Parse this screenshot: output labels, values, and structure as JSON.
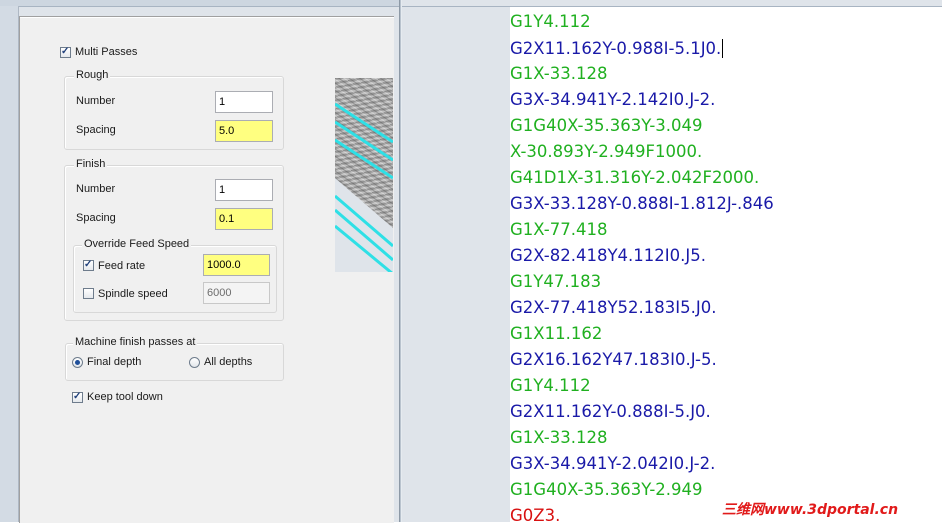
{
  "dialog": {
    "multi_passes": {
      "label": "Multi Passes",
      "checked": true
    },
    "rough": {
      "caption": "Rough",
      "number_label": "Number",
      "number_value": "1",
      "spacing_label": "Spacing",
      "spacing_value": "5.0"
    },
    "finish": {
      "caption": "Finish",
      "number_label": "Number",
      "number_value": "1",
      "spacing_label": "Spacing",
      "spacing_value": "0.1",
      "override": {
        "caption": "Override Feed Speed",
        "feed_rate_label": "Feed rate",
        "feed_rate_checked": true,
        "feed_rate_value": "1000.0",
        "spindle_label": "Spindle speed",
        "spindle_checked": false,
        "spindle_value": "6000"
      }
    },
    "machine_finish": {
      "caption": "Machine finish passes at",
      "final_depth_label": "Final depth",
      "final_depth_selected": true,
      "all_depths_label": "All depths",
      "all_depths_selected": false
    },
    "keep_tool_down": {
      "label": "Keep tool down",
      "checked": true
    }
  },
  "colors": {
    "green": "#20b020",
    "blue": "#1a1aa8",
    "red": "#d81010",
    "field_highlight": "#ffff80"
  },
  "code_lines": [
    {
      "text": "G1Y4.112",
      "color": "green"
    },
    {
      "text": "G2X11.162Y-0.988I-5.1J0.",
      "color": "blue"
    },
    {
      "text": "G1X-33.128",
      "color": "green"
    },
    {
      "text": "G3X-34.941Y-2.142I0.J-2.",
      "color": "blue"
    },
    {
      "text": "G1G40X-35.363Y-3.049",
      "color": "green"
    },
    {
      "text": "X-30.893Y-2.949F1000.",
      "color": "green"
    },
    {
      "text": "G41D1X-31.316Y-2.042F2000.",
      "color": "green"
    },
    {
      "text": "G3X-33.128Y-0.888I-1.812J-.846",
      "color": "blue"
    },
    {
      "text": "G1X-77.418",
      "color": "green"
    },
    {
      "text": "G2X-82.418Y4.112I0.J5.",
      "color": "blue"
    },
    {
      "text": "G1Y47.183",
      "color": "green"
    },
    {
      "text": "G2X-77.418Y52.183I5.J0.",
      "color": "blue"
    },
    {
      "text": "G1X11.162",
      "color": "green"
    },
    {
      "text": "G2X16.162Y47.183I0.J-5.",
      "color": "blue"
    },
    {
      "text": "G1Y4.112",
      "color": "green"
    },
    {
      "text": "G2X11.162Y-0.888I-5.J0.",
      "color": "blue"
    },
    {
      "text": "G1X-33.128",
      "color": "green"
    },
    {
      "text": "G3X-34.941Y-2.042I0.J-2.",
      "color": "blue"
    },
    {
      "text": "G1G40X-35.363Y-2.949",
      "color": "green"
    },
    {
      "text": "G0Z3.",
      "color": "red"
    }
  ],
  "watermark": "三维网www.3dportal.cn"
}
